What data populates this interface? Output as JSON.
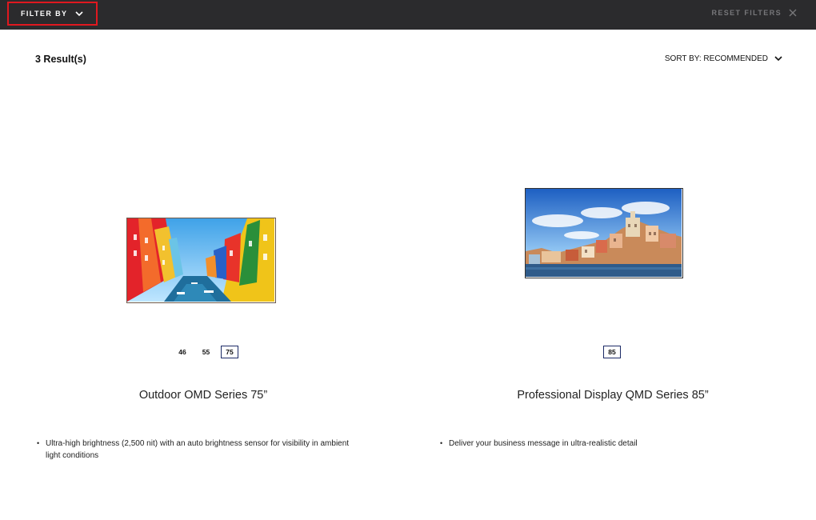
{
  "topbar": {
    "filter_label": "FILTER BY",
    "reset_label": "RESET FILTERS",
    "highlight_color": "#e0181f"
  },
  "results_label": "3 Result(s)",
  "sort_label": "SORT BY: RECOMMENDED",
  "products": [
    {
      "image": "outdoor-display-colorful-houses",
      "sizes": [
        "46",
        "55",
        "75"
      ],
      "selected_size": "75",
      "title": "Outdoor OMD Series 75”",
      "features": [
        "Ultra-high brightness (2,500 nit) with an auto brightness sensor for visibility in ambient light conditions"
      ]
    },
    {
      "image": "professional-display-coastal-town",
      "sizes": [
        "85"
      ],
      "selected_size": "85",
      "title": "Professional Display QMD Series 85”",
      "features": [
        "Deliver your business message in ultra-realistic detail"
      ]
    }
  ]
}
